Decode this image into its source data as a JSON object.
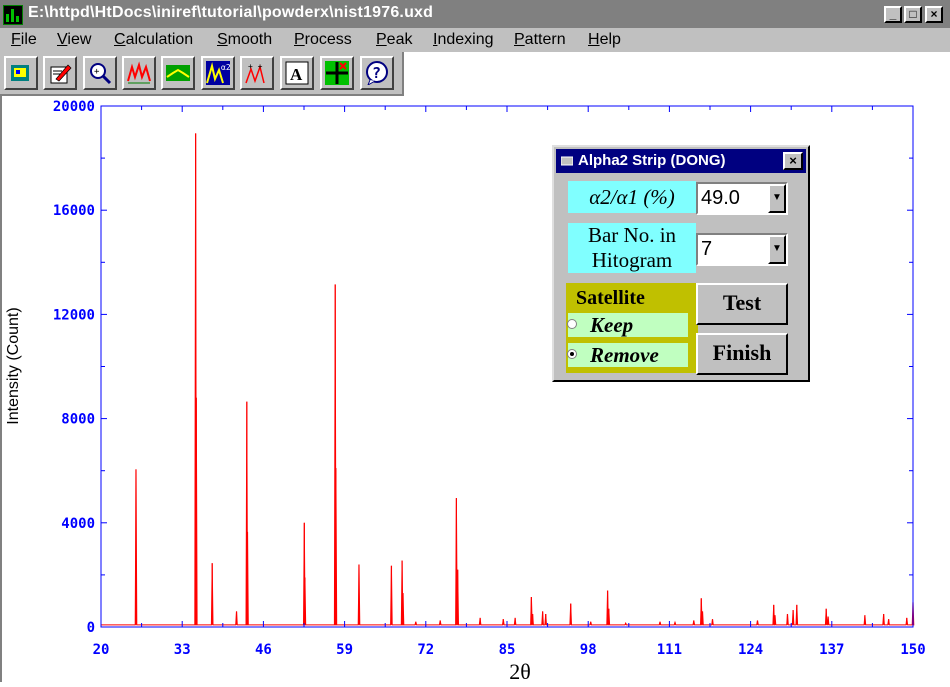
{
  "window": {
    "title": "E:\\httpd\\HtDocs\\iniref\\tutorial\\powderx\\nist1976.uxd",
    "buttons": {
      "minimize": "_",
      "maximize": "□",
      "close": "×"
    }
  },
  "menu": [
    {
      "label": "File",
      "underline": "F",
      "rest": "ile"
    },
    {
      "label": "View",
      "underline": "V",
      "rest": "iew"
    },
    {
      "label": "Calculation",
      "underline": "C",
      "rest": "alculation"
    },
    {
      "label": "Smooth",
      "underline": "S",
      "rest": "mooth"
    },
    {
      "label": "Process",
      "underline": "P",
      "rest": "rocess"
    },
    {
      "label": "Peak",
      "underline": "P",
      "rest": "eak"
    },
    {
      "label": "Indexing",
      "underline": "I",
      "rest": "ndexing"
    },
    {
      "label": "Pattern",
      "underline": "P",
      "rest": "attern"
    },
    {
      "label": "Help",
      "underline": "H",
      "rest": "elp"
    }
  ],
  "toolbar": {
    "icons": [
      "open-file-icon",
      "edit-data-icon",
      "zoom-icon",
      "smooth-peaks-icon",
      "background-icon",
      "alpha2-strip-icon",
      "peak-search-icon",
      "text-annotation-icon",
      "crosshair-icon",
      "help-icon"
    ],
    "text_tool_glyph": "A",
    "help_glyph": "?"
  },
  "chart_data": {
    "type": "line",
    "xlabel": "2θ",
    "ylabel": "Intensity (Count)",
    "xlim": [
      20,
      150
    ],
    "ylim": [
      0,
      20000
    ],
    "x_ticks": [
      "20",
      "33",
      "46",
      "59",
      "72",
      "85",
      "98",
      "111",
      "124",
      "137",
      "150"
    ],
    "y_ticks": [
      "0",
      "4000",
      "8000",
      "12000",
      "16000",
      "20000"
    ],
    "grid": false,
    "colors": {
      "series": "#ff0000",
      "axes": "#0000ff",
      "tick_labels": "#0000ff"
    },
    "series": [
      {
        "baseline": 80,
        "peaks": [
          {
            "x": 25.6,
            "y": 6050
          },
          {
            "x": 35.15,
            "y": 18950
          },
          {
            "x": 35.25,
            "y": 8800
          },
          {
            "x": 37.8,
            "y": 2450
          },
          {
            "x": 41.7,
            "y": 600
          },
          {
            "x": 43.35,
            "y": 8650
          },
          {
            "x": 43.45,
            "y": 3650
          },
          {
            "x": 52.55,
            "y": 4000
          },
          {
            "x": 52.65,
            "y": 1900
          },
          {
            "x": 57.5,
            "y": 13150
          },
          {
            "x": 57.6,
            "y": 6100
          },
          {
            "x": 61.3,
            "y": 2400
          },
          {
            "x": 66.5,
            "y": 2350
          },
          {
            "x": 68.2,
            "y": 2550
          },
          {
            "x": 68.35,
            "y": 1300
          },
          {
            "x": 70.4,
            "y": 200
          },
          {
            "x": 74.3,
            "y": 250
          },
          {
            "x": 76.9,
            "y": 4950
          },
          {
            "x": 77.1,
            "y": 2200
          },
          {
            "x": 80.7,
            "y": 350
          },
          {
            "x": 84.4,
            "y": 300
          },
          {
            "x": 86.3,
            "y": 350
          },
          {
            "x": 88.9,
            "y": 1150
          },
          {
            "x": 89.1,
            "y": 500
          },
          {
            "x": 90.7,
            "y": 600
          },
          {
            "x": 91.2,
            "y": 500
          },
          {
            "x": 95.2,
            "y": 900
          },
          {
            "x": 98.4,
            "y": 200
          },
          {
            "x": 101.1,
            "y": 1400
          },
          {
            "x": 101.3,
            "y": 700
          },
          {
            "x": 104.0,
            "y": 150
          },
          {
            "x": 109.5,
            "y": 200
          },
          {
            "x": 111.9,
            "y": 180
          },
          {
            "x": 114.9,
            "y": 250
          },
          {
            "x": 116.1,
            "y": 1100
          },
          {
            "x": 116.3,
            "y": 600
          },
          {
            "x": 117.9,
            "y": 300
          },
          {
            "x": 125.1,
            "y": 250
          },
          {
            "x": 127.7,
            "y": 850
          },
          {
            "x": 127.9,
            "y": 450
          },
          {
            "x": 129.9,
            "y": 500
          },
          {
            "x": 130.8,
            "y": 650
          },
          {
            "x": 131.4,
            "y": 850
          },
          {
            "x": 136.1,
            "y": 700
          },
          {
            "x": 136.4,
            "y": 400
          },
          {
            "x": 142.3,
            "y": 450
          },
          {
            "x": 145.3,
            "y": 500
          },
          {
            "x": 146.1,
            "y": 300
          },
          {
            "x": 149.0,
            "y": 350
          },
          {
            "x": 150.0,
            "y": 950
          }
        ]
      }
    ]
  },
  "dialog": {
    "title": "Alpha2 Strip (DONG)",
    "close": "×",
    "ratio_label": "α2/α1 (%)",
    "ratio_value": "49.0",
    "bar_label_line1": "Bar No. in",
    "bar_label_line2": "Hitogram",
    "bar_value": "7",
    "satellite_title": "Satellite",
    "keep_label": "Keep",
    "remove_label": "Remove",
    "satellite_selected": "Remove",
    "test_button": "Test",
    "finish_button": "Finish",
    "dropdown_arrow": "▼"
  }
}
